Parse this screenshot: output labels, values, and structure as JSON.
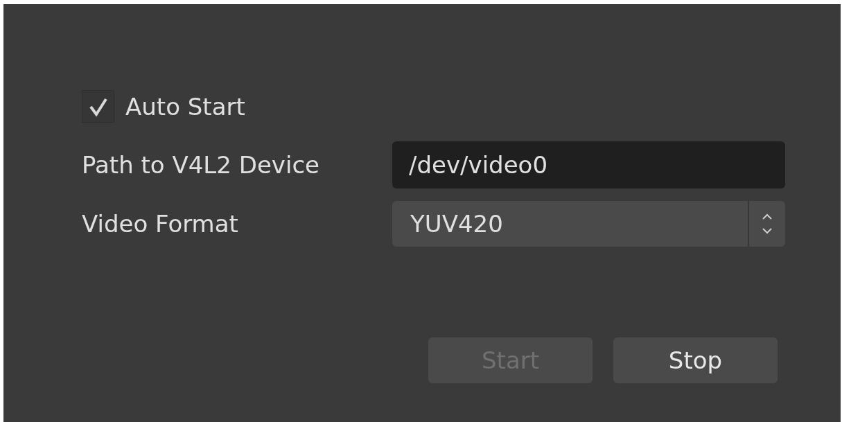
{
  "auto_start": {
    "label": "Auto Start",
    "checked": true
  },
  "fields": [
    {
      "kind": "text",
      "label": "Path to V4L2 Device",
      "value": "/dev/video0"
    },
    {
      "kind": "select",
      "label": "Video Format",
      "value": "YUV420"
    }
  ],
  "buttons": [
    {
      "label": "Start",
      "disabled": true
    },
    {
      "label": "Stop",
      "disabled": false
    }
  ]
}
